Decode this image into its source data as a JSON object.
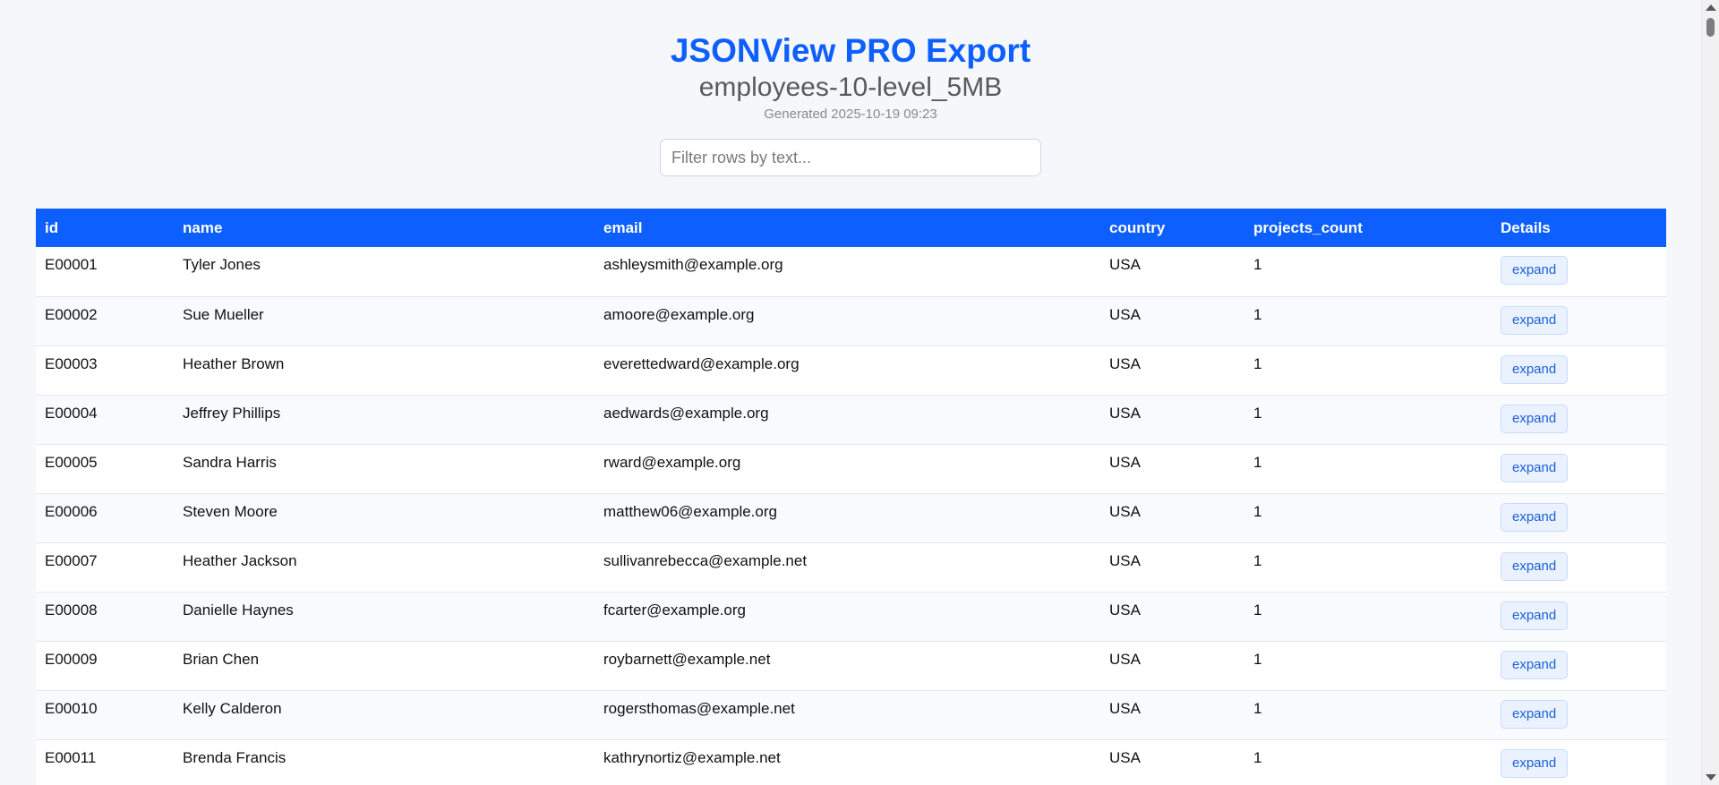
{
  "header": {
    "title": "JSONView PRO Export",
    "subtitle": "employees-10-level_5MB",
    "generated": "Generated 2025-10-19 09:23"
  },
  "search": {
    "placeholder": "Filter rows by text...",
    "value": ""
  },
  "colors": {
    "accent": "#0d5fff",
    "button_bg": "#ebf2ff",
    "button_text": "#1c5fd6"
  },
  "table": {
    "columns": [
      "id",
      "name",
      "email",
      "country",
      "projects_count",
      "Details"
    ],
    "expand_label": "expand",
    "rows": [
      {
        "id": "E00001",
        "name": "Tyler Jones",
        "email": "ashleysmith@example.org",
        "country": "USA",
        "projects_count": "1"
      },
      {
        "id": "E00002",
        "name": "Sue Mueller",
        "email": "amoore@example.org",
        "country": "USA",
        "projects_count": "1"
      },
      {
        "id": "E00003",
        "name": "Heather Brown",
        "email": "everettedward@example.org",
        "country": "USA",
        "projects_count": "1"
      },
      {
        "id": "E00004",
        "name": "Jeffrey Phillips",
        "email": "aedwards@example.org",
        "country": "USA",
        "projects_count": "1"
      },
      {
        "id": "E00005",
        "name": "Sandra Harris",
        "email": "rward@example.org",
        "country": "USA",
        "projects_count": "1"
      },
      {
        "id": "E00006",
        "name": "Steven Moore",
        "email": "matthew06@example.org",
        "country": "USA",
        "projects_count": "1"
      },
      {
        "id": "E00007",
        "name": "Heather Jackson",
        "email": "sullivanrebecca@example.net",
        "country": "USA",
        "projects_count": "1"
      },
      {
        "id": "E00008",
        "name": "Danielle Haynes",
        "email": "fcarter@example.org",
        "country": "USA",
        "projects_count": "1"
      },
      {
        "id": "E00009",
        "name": "Brian Chen",
        "email": "roybarnett@example.net",
        "country": "USA",
        "projects_count": "1"
      },
      {
        "id": "E00010",
        "name": "Kelly Calderon",
        "email": "rogersthomas@example.net",
        "country": "USA",
        "projects_count": "1"
      },
      {
        "id": "E00011",
        "name": "Brenda Francis",
        "email": "kathrynortiz@example.net",
        "country": "USA",
        "projects_count": "1"
      }
    ]
  }
}
